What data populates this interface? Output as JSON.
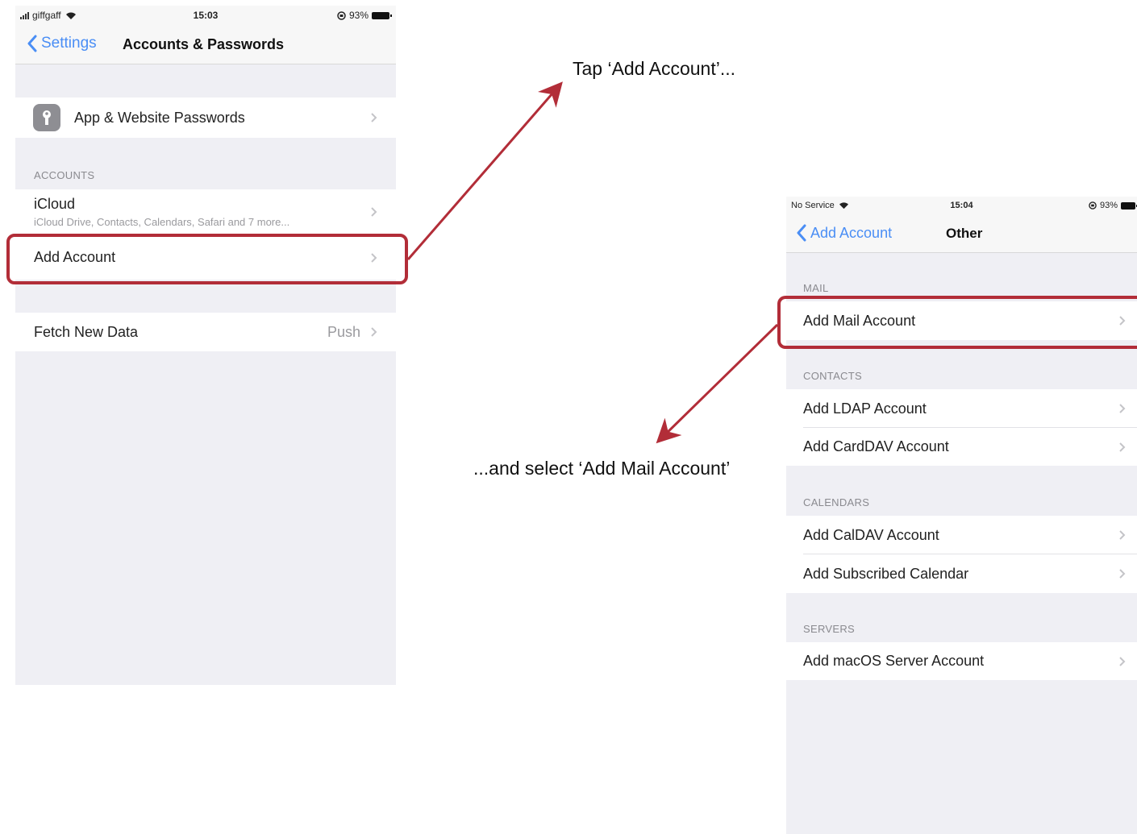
{
  "left_screen": {
    "status": {
      "carrier": "giffgaff",
      "time": "15:03",
      "battery": "93%"
    },
    "nav": {
      "back_label": "Settings",
      "title": "Accounts & Passwords"
    },
    "passwords_row": {
      "label": "App & Website Passwords"
    },
    "accounts_header": "ACCOUNTS",
    "icloud": {
      "label": "iCloud",
      "sublabel": "iCloud Drive, Contacts, Calendars, Safari and 7 more..."
    },
    "add_account": {
      "label": "Add Account"
    },
    "fetch": {
      "label": "Fetch New Data",
      "value": "Push"
    }
  },
  "right_screen": {
    "status": {
      "carrier": "No Service",
      "time": "15:04",
      "battery": "93%"
    },
    "nav": {
      "back_label": "Add Account",
      "title": "Other"
    },
    "sections": {
      "mail": {
        "header": "MAIL",
        "items": [
          "Add Mail Account"
        ]
      },
      "contacts": {
        "header": "CONTACTS",
        "items": [
          "Add LDAP Account",
          "Add CardDAV Account"
        ]
      },
      "calendars": {
        "header": "CALENDARS",
        "items": [
          "Add CalDAV Account",
          "Add Subscribed Calendar"
        ]
      },
      "servers": {
        "header": "SERVERS",
        "items": [
          "Add macOS Server Account"
        ]
      }
    }
  },
  "annotations": {
    "step1": "Tap ‘Add Account’...",
    "step2": "...and select ‘Add Mail Account’"
  },
  "colors": {
    "highlight": "#b22d38",
    "ios_blue": "#4a8ef5",
    "group_bg": "#efeff4"
  }
}
